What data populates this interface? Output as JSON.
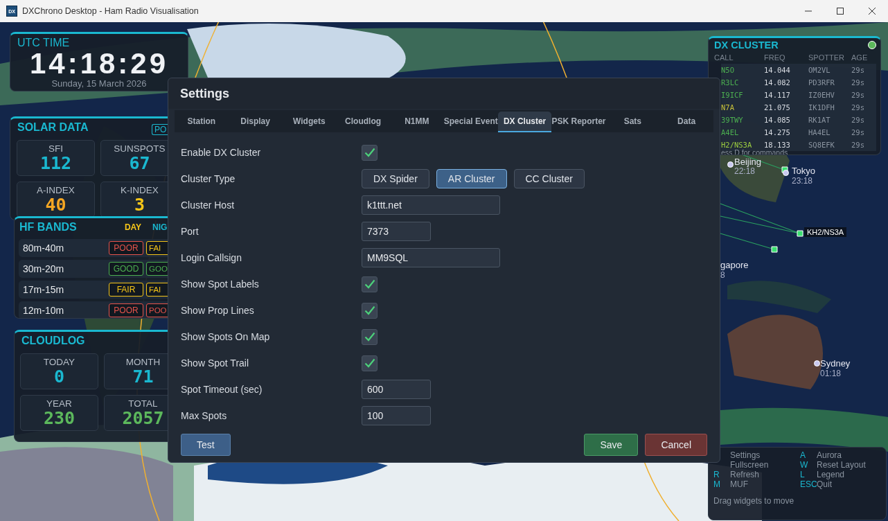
{
  "window": {
    "logo": "DX",
    "title": "DXChrono Desktop - Ham Radio Visualisation"
  },
  "map": {
    "kind": "picture",
    "labels": [
      {
        "name": "Beijing",
        "time": "22:18"
      },
      {
        "name": "Tokyo",
        "time": "23:18"
      },
      {
        "name": "gapore",
        "time": "8"
      },
      {
        "name": "Sydney",
        "time": "01:18"
      }
    ],
    "spot_label": "KH2/NS3A"
  },
  "utc_time": {
    "title": "UTC TIME",
    "time": "14:18:29",
    "date": "Sunday, 15 March 2026"
  },
  "solar_data": {
    "title": "SOLAR DATA",
    "badge": "PO",
    "stats": [
      {
        "label": "SFI",
        "value": "112",
        "color": "#1ab8d0"
      },
      {
        "label": "SUNSPOTS",
        "value": "67",
        "color": "#1ab8d0"
      },
      {
        "label": "A-INDEX",
        "value": "40",
        "color": "#f5a623"
      },
      {
        "label": "K-INDEX",
        "value": "3",
        "color": "#f5c518"
      }
    ]
  },
  "hf_bands": {
    "title": "HF BANDS",
    "day_label": "DAY",
    "night_label": "NIG",
    "bands": [
      {
        "name": "80m-40m",
        "day": {
          "text": "POOR",
          "color": "#e5534b"
        },
        "night": {
          "text": "FAI",
          "color": "#f5c518"
        }
      },
      {
        "name": "30m-20m",
        "day": {
          "text": "GOOD",
          "color": "#4caf50"
        },
        "night": {
          "text": "GOO",
          "color": "#4caf50"
        }
      },
      {
        "name": "17m-15m",
        "day": {
          "text": "FAIR",
          "color": "#f5c518"
        },
        "night": {
          "text": "FAI",
          "color": "#f5c518"
        }
      },
      {
        "name": "12m-10m",
        "day": {
          "text": "POOR",
          "color": "#e5534b"
        },
        "night": {
          "text": "POO",
          "color": "#e5534b"
        }
      }
    ]
  },
  "cloudlog": {
    "title": "CLOUDLOG",
    "stats": [
      {
        "label": "TODAY",
        "value": "0",
        "color": "#1ab8d0"
      },
      {
        "label": "MONTH",
        "value": "71",
        "color": "#1ab8d0"
      },
      {
        "label": "YEAR",
        "value": "230",
        "color": "#5cb85c"
      },
      {
        "label": "TOTAL",
        "value": "2057",
        "color": "#5cb85c"
      }
    ]
  },
  "dx_cluster": {
    "title": "DX CLUSTER",
    "connected": true,
    "columns": [
      "CALL",
      "FREQ",
      "SPOTTER",
      "AGE"
    ],
    "spots": [
      {
        "call": "N5O",
        "freq": "14.044",
        "spotter": "OM2VL",
        "age": "29s",
        "color": "#4caf50"
      },
      {
        "call": "R3LC",
        "freq": "14.082",
        "spotter": "PD3RFR",
        "age": "29s",
        "color": "#4caf50"
      },
      {
        "call": "I9ICF",
        "freq": "14.117",
        "spotter": "IZ0EHV",
        "age": "29s",
        "color": "#4caf50"
      },
      {
        "call": "N7A",
        "freq": "21.075",
        "spotter": "IK1DFH",
        "age": "29s",
        "color": "#c8c23a"
      },
      {
        "call": "39TWY",
        "freq": "14.085",
        "spotter": "RK1AT",
        "age": "29s",
        "color": "#4caf50"
      },
      {
        "call": "A4EL",
        "freq": "14.275",
        "spotter": "HA4EL",
        "age": "29s",
        "color": "#4caf50"
      },
      {
        "call": "H2/NS3A",
        "freq": "18.133",
        "spotter": "SQ8EFK",
        "age": "29s",
        "color": "#9ccc40"
      }
    ],
    "hint": "ess D for commands"
  },
  "settings": {
    "title": "Settings",
    "tabs": [
      {
        "label": "Station",
        "selected": false
      },
      {
        "label": "Display",
        "selected": false
      },
      {
        "label": "Widgets",
        "selected": false
      },
      {
        "label": "Cloudlog",
        "selected": false
      },
      {
        "label": "N1MM",
        "selected": false
      },
      {
        "label": "Special Event",
        "selected": false
      },
      {
        "label": "DX Cluster",
        "selected": true
      },
      {
        "label": "PSK Reporter",
        "selected": false
      },
      {
        "label": "Sats",
        "selected": false
      },
      {
        "label": "Data",
        "selected": false
      }
    ],
    "rows": [
      {
        "kind": "checkbox",
        "label": "Enable DX Cluster",
        "checked": true
      },
      {
        "kind": "choice",
        "label": "Cluster Type",
        "options": [
          {
            "label": "DX Spider",
            "selected": false
          },
          {
            "label": "AR Cluster",
            "selected": true
          },
          {
            "label": "CC Cluster",
            "selected": false
          }
        ]
      },
      {
        "kind": "input",
        "label": "Cluster Host",
        "value": "k1ttt.net"
      },
      {
        "kind": "number",
        "label": "Port",
        "value": "7373"
      },
      {
        "kind": "input",
        "label": "Login Callsign",
        "value": "MM9SQL"
      },
      {
        "kind": "checkbox",
        "label": "Show Spot Labels",
        "checked": true
      },
      {
        "kind": "checkbox",
        "label": "Show Prop Lines",
        "checked": true
      },
      {
        "kind": "checkbox",
        "label": "Show Spots On Map",
        "checked": true
      },
      {
        "kind": "checkbox",
        "label": "Show Spot Trail",
        "checked": true
      },
      {
        "kind": "number",
        "label": "Spot Timeout (sec)",
        "value": "600"
      },
      {
        "kind": "number",
        "label": "Max Spots",
        "value": "100"
      }
    ],
    "buttons": [
      {
        "label": "Test",
        "kind": "neutral"
      },
      {
        "label": "Save",
        "kind": "primary"
      },
      {
        "label": "Cancel",
        "kind": "danger"
      }
    ]
  },
  "shortcuts": {
    "items": [
      {
        "label": "Settings"
      },
      {
        "label": "Fullscreen"
      },
      {
        "key": "R",
        "label": "Refresh"
      },
      {
        "key": "M",
        "label": "MUF"
      },
      {
        "key": "A",
        "label": "Aurora"
      },
      {
        "key": "W",
        "label": "Reset Layout"
      },
      {
        "key": "L",
        "label": "Legend"
      },
      {
        "key": "ESC",
        "label": "Quit"
      }
    ],
    "hint": "Drag widgets to move"
  }
}
